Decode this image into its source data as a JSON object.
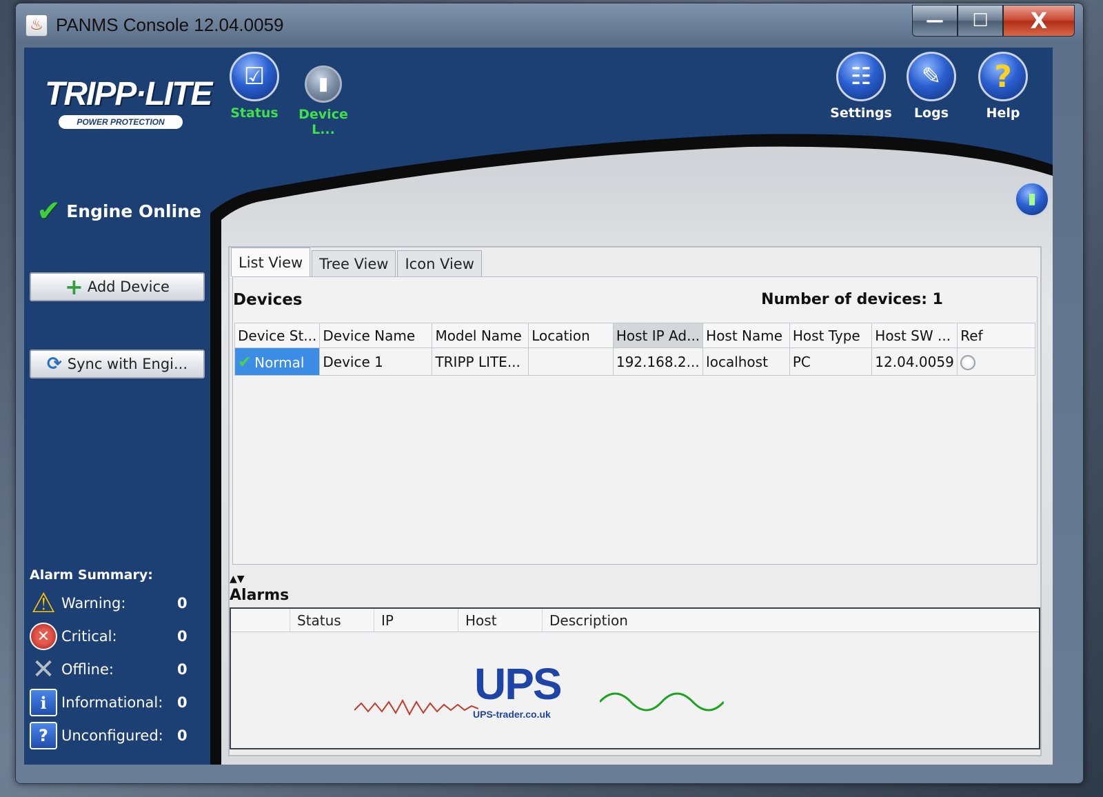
{
  "window": {
    "title": "PANMS Console 12.04.0059",
    "minimize": "—",
    "maximize": "☐",
    "close": "X"
  },
  "logo": {
    "main": "TRIPP·LITE",
    "sub": "POWER PROTECTION"
  },
  "toolbar": {
    "status": "Status",
    "device_list": "Device L...",
    "settings": "Settings",
    "logs": "Logs",
    "help": "Help"
  },
  "engine": {
    "label": "Engine Online"
  },
  "sidebar": {
    "add_device": "Add Device",
    "sync": "Sync with Engi..."
  },
  "alarm_summary": {
    "title": "Alarm Summary:",
    "items": [
      {
        "label": "Warning:",
        "count": "0",
        "icon": "warning-icon"
      },
      {
        "label": "Critical:",
        "count": "0",
        "icon": "critical-icon"
      },
      {
        "label": "Offline:",
        "count": "0",
        "icon": "offline-icon"
      },
      {
        "label": "Informational:",
        "count": "0",
        "icon": "info-icon"
      },
      {
        "label": "Unconfigured:",
        "count": "0",
        "icon": "unconfigured-icon"
      }
    ]
  },
  "tabs": [
    "List View",
    "Tree View",
    "Icon View"
  ],
  "devices": {
    "title": "Devices",
    "count_label": "Number of devices: 1",
    "columns": [
      "Device St...",
      "Device Name",
      "Model Name",
      "Location",
      "Host IP Ad...",
      "Host Name",
      "Host Type",
      "Host SW ...",
      "Ref"
    ],
    "rows": [
      {
        "status": "Normal",
        "name": "Device 1",
        "model": "TRIPP LITE...",
        "location": "",
        "ip": "192.168.2...",
        "host": "localhost",
        "type": "PC",
        "sw": "12.04.0059"
      }
    ]
  },
  "alarms": {
    "title": "Alarms",
    "columns": [
      "",
      "Status",
      "IP",
      "Host",
      "Description"
    ]
  },
  "watermark": {
    "text": "UPS",
    "sub": "UPS-trader.co.uk"
  },
  "colors": {
    "sidebar_bg": "#1c3f74",
    "accent_green": "#40e04a",
    "selection_blue": "#3c8de6"
  }
}
